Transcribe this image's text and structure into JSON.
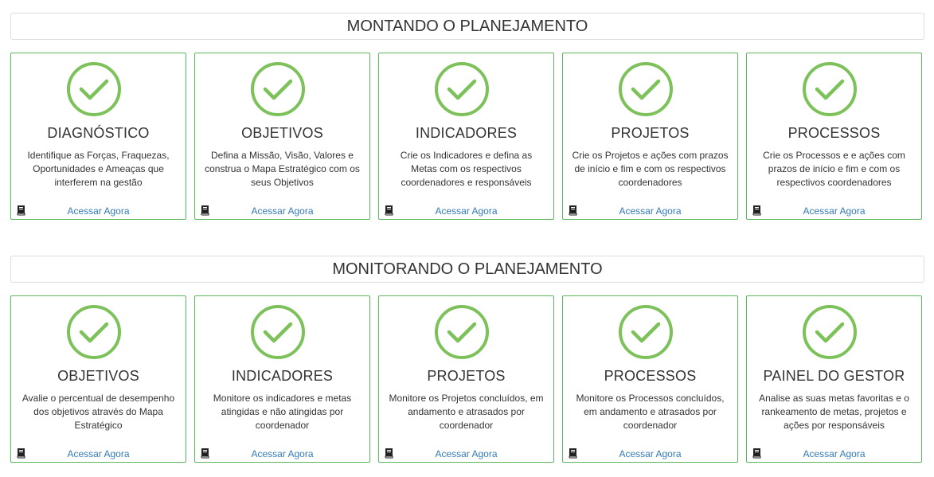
{
  "sections": [
    {
      "title": "MONTANDO O PLANEJAMENTO",
      "cards": [
        {
          "title": "DIAGNÓSTICO",
          "description": "Identifique as Forças, Fraquezas, Oportunidades e Ameaças que interferem na gestão",
          "link": "Acessar Agora"
        },
        {
          "title": "OBJETIVOS",
          "description": "Defina a Missão, Visão, Valores e construa o Mapa Estratégico com os seus Objetivos",
          "link": "Acessar Agora"
        },
        {
          "title": "INDICADORES",
          "description": "Crie os Indicadores e defina as Metas com os respectivos coordenadores e responsáveis",
          "link": "Acessar Agora"
        },
        {
          "title": "PROJETOS",
          "description": "Crie os Projetos e ações com prazos de início e fim e com os respectivos coordenadores",
          "link": "Acessar Agora"
        },
        {
          "title": "PROCESSOS",
          "description": "Crie os Processos e e ações com prazos de início e fim e com os respectivos coordenadores",
          "link": "Acessar Agora"
        }
      ]
    },
    {
      "title": "MONITORANDO O PLANEJAMENTO",
      "cards": [
        {
          "title": "OBJETIVOS",
          "description": "Avalie o percentual de desempenho dos objetivos através do Mapa Estratégico",
          "link": "Acessar Agora"
        },
        {
          "title": "INDICADORES",
          "description": "Monitore os indicadores e metas atingidas e não atingidas por coordenador",
          "link": "Acessar Agora"
        },
        {
          "title": "PROJETOS",
          "description": "Monitore os Projetos concluídos, em andamento e atrasados por coordenador",
          "link": "Acessar Agora"
        },
        {
          "title": "PROCESSOS",
          "description": "Monitore os Processos concluídos, em andamento e atrasados por coordenador",
          "link": "Acessar Agora"
        },
        {
          "title": "PAINEL DO GESTOR",
          "description": "Analise as suas metas favoritas e o rankeamento de metas, projetos e ações por responsáveis",
          "link": "Acessar Agora"
        }
      ]
    }
  ],
  "icons": {
    "status": "check-circle-icon",
    "link": "book-icon"
  },
  "colors": {
    "accent": "#5cb85c",
    "check": "#7dc15b",
    "link": "#337ab7"
  }
}
